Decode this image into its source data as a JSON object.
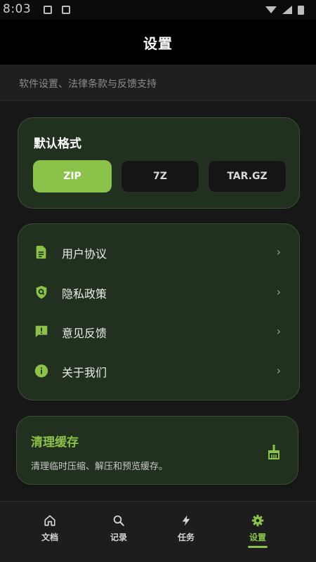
{
  "status_bar": {
    "time": "8:03"
  },
  "app_bar": {
    "title": "设置"
  },
  "subtitle": "软件设置、法律条款与反馈支持",
  "default_format": {
    "heading": "默认格式",
    "options": [
      {
        "label": "ZIP",
        "selected": true
      },
      {
        "label": "7Z",
        "selected": false
      },
      {
        "label": "TAR.GZ",
        "selected": false
      }
    ]
  },
  "menu": {
    "items": [
      {
        "label": "用户协议",
        "icon": "document-icon"
      },
      {
        "label": "隐私政策",
        "icon": "privacy-shield-icon"
      },
      {
        "label": "意见反馈",
        "icon": "feedback-icon"
      },
      {
        "label": "关于我们",
        "icon": "info-icon"
      }
    ],
    "chevron": "›"
  },
  "cache": {
    "heading": "清理缓存",
    "description": "清理临时压缩、解压和预览缓存。",
    "icon": "broom-icon"
  },
  "bottom_nav": {
    "items": [
      {
        "label": "文档",
        "icon": "home-icon",
        "active": false
      },
      {
        "label": "记录",
        "icon": "search-icon",
        "active": false
      },
      {
        "label": "任务",
        "icon": "bolt-icon",
        "active": false
      },
      {
        "label": "设置",
        "icon": "gear-icon",
        "active": true
      }
    ]
  },
  "colors": {
    "accent": "#8bc34a",
    "card_bg": "#22311f",
    "background": "#171717"
  }
}
